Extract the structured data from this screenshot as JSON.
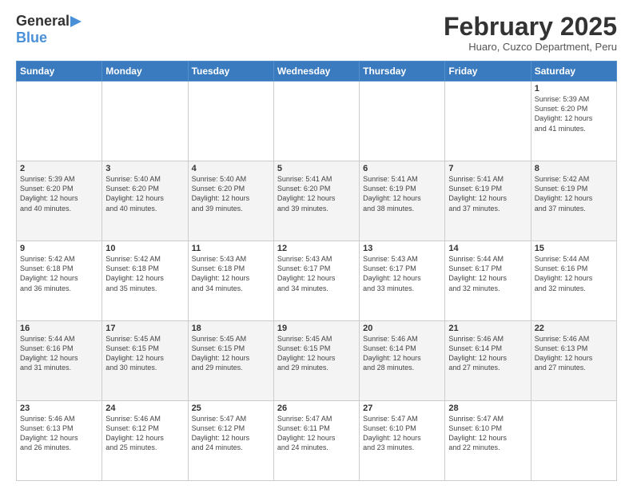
{
  "header": {
    "logo_line1": "General",
    "logo_line2": "Blue",
    "month_title": "February 2025",
    "location": "Huaro, Cuzco Department, Peru"
  },
  "days_of_week": [
    "Sunday",
    "Monday",
    "Tuesday",
    "Wednesday",
    "Thursday",
    "Friday",
    "Saturday"
  ],
  "weeks": [
    [
      {
        "day": "",
        "info": ""
      },
      {
        "day": "",
        "info": ""
      },
      {
        "day": "",
        "info": ""
      },
      {
        "day": "",
        "info": ""
      },
      {
        "day": "",
        "info": ""
      },
      {
        "day": "",
        "info": ""
      },
      {
        "day": "1",
        "info": "Sunrise: 5:39 AM\nSunset: 6:20 PM\nDaylight: 12 hours\nand 41 minutes."
      }
    ],
    [
      {
        "day": "2",
        "info": "Sunrise: 5:39 AM\nSunset: 6:20 PM\nDaylight: 12 hours\nand 40 minutes."
      },
      {
        "day": "3",
        "info": "Sunrise: 5:40 AM\nSunset: 6:20 PM\nDaylight: 12 hours\nand 40 minutes."
      },
      {
        "day": "4",
        "info": "Sunrise: 5:40 AM\nSunset: 6:20 PM\nDaylight: 12 hours\nand 39 minutes."
      },
      {
        "day": "5",
        "info": "Sunrise: 5:41 AM\nSunset: 6:20 PM\nDaylight: 12 hours\nand 39 minutes."
      },
      {
        "day": "6",
        "info": "Sunrise: 5:41 AM\nSunset: 6:19 PM\nDaylight: 12 hours\nand 38 minutes."
      },
      {
        "day": "7",
        "info": "Sunrise: 5:41 AM\nSunset: 6:19 PM\nDaylight: 12 hours\nand 37 minutes."
      },
      {
        "day": "8",
        "info": "Sunrise: 5:42 AM\nSunset: 6:19 PM\nDaylight: 12 hours\nand 37 minutes."
      }
    ],
    [
      {
        "day": "9",
        "info": "Sunrise: 5:42 AM\nSunset: 6:18 PM\nDaylight: 12 hours\nand 36 minutes."
      },
      {
        "day": "10",
        "info": "Sunrise: 5:42 AM\nSunset: 6:18 PM\nDaylight: 12 hours\nand 35 minutes."
      },
      {
        "day": "11",
        "info": "Sunrise: 5:43 AM\nSunset: 6:18 PM\nDaylight: 12 hours\nand 34 minutes."
      },
      {
        "day": "12",
        "info": "Sunrise: 5:43 AM\nSunset: 6:17 PM\nDaylight: 12 hours\nand 34 minutes."
      },
      {
        "day": "13",
        "info": "Sunrise: 5:43 AM\nSunset: 6:17 PM\nDaylight: 12 hours\nand 33 minutes."
      },
      {
        "day": "14",
        "info": "Sunrise: 5:44 AM\nSunset: 6:17 PM\nDaylight: 12 hours\nand 32 minutes."
      },
      {
        "day": "15",
        "info": "Sunrise: 5:44 AM\nSunset: 6:16 PM\nDaylight: 12 hours\nand 32 minutes."
      }
    ],
    [
      {
        "day": "16",
        "info": "Sunrise: 5:44 AM\nSunset: 6:16 PM\nDaylight: 12 hours\nand 31 minutes."
      },
      {
        "day": "17",
        "info": "Sunrise: 5:45 AM\nSunset: 6:15 PM\nDaylight: 12 hours\nand 30 minutes."
      },
      {
        "day": "18",
        "info": "Sunrise: 5:45 AM\nSunset: 6:15 PM\nDaylight: 12 hours\nand 29 minutes."
      },
      {
        "day": "19",
        "info": "Sunrise: 5:45 AM\nSunset: 6:15 PM\nDaylight: 12 hours\nand 29 minutes."
      },
      {
        "day": "20",
        "info": "Sunrise: 5:46 AM\nSunset: 6:14 PM\nDaylight: 12 hours\nand 28 minutes."
      },
      {
        "day": "21",
        "info": "Sunrise: 5:46 AM\nSunset: 6:14 PM\nDaylight: 12 hours\nand 27 minutes."
      },
      {
        "day": "22",
        "info": "Sunrise: 5:46 AM\nSunset: 6:13 PM\nDaylight: 12 hours\nand 27 minutes."
      }
    ],
    [
      {
        "day": "23",
        "info": "Sunrise: 5:46 AM\nSunset: 6:13 PM\nDaylight: 12 hours\nand 26 minutes."
      },
      {
        "day": "24",
        "info": "Sunrise: 5:46 AM\nSunset: 6:12 PM\nDaylight: 12 hours\nand 25 minutes."
      },
      {
        "day": "25",
        "info": "Sunrise: 5:47 AM\nSunset: 6:12 PM\nDaylight: 12 hours\nand 24 minutes."
      },
      {
        "day": "26",
        "info": "Sunrise: 5:47 AM\nSunset: 6:11 PM\nDaylight: 12 hours\nand 24 minutes."
      },
      {
        "day": "27",
        "info": "Sunrise: 5:47 AM\nSunset: 6:10 PM\nDaylight: 12 hours\nand 23 minutes."
      },
      {
        "day": "28",
        "info": "Sunrise: 5:47 AM\nSunset: 6:10 PM\nDaylight: 12 hours\nand 22 minutes."
      },
      {
        "day": "",
        "info": ""
      }
    ]
  ]
}
